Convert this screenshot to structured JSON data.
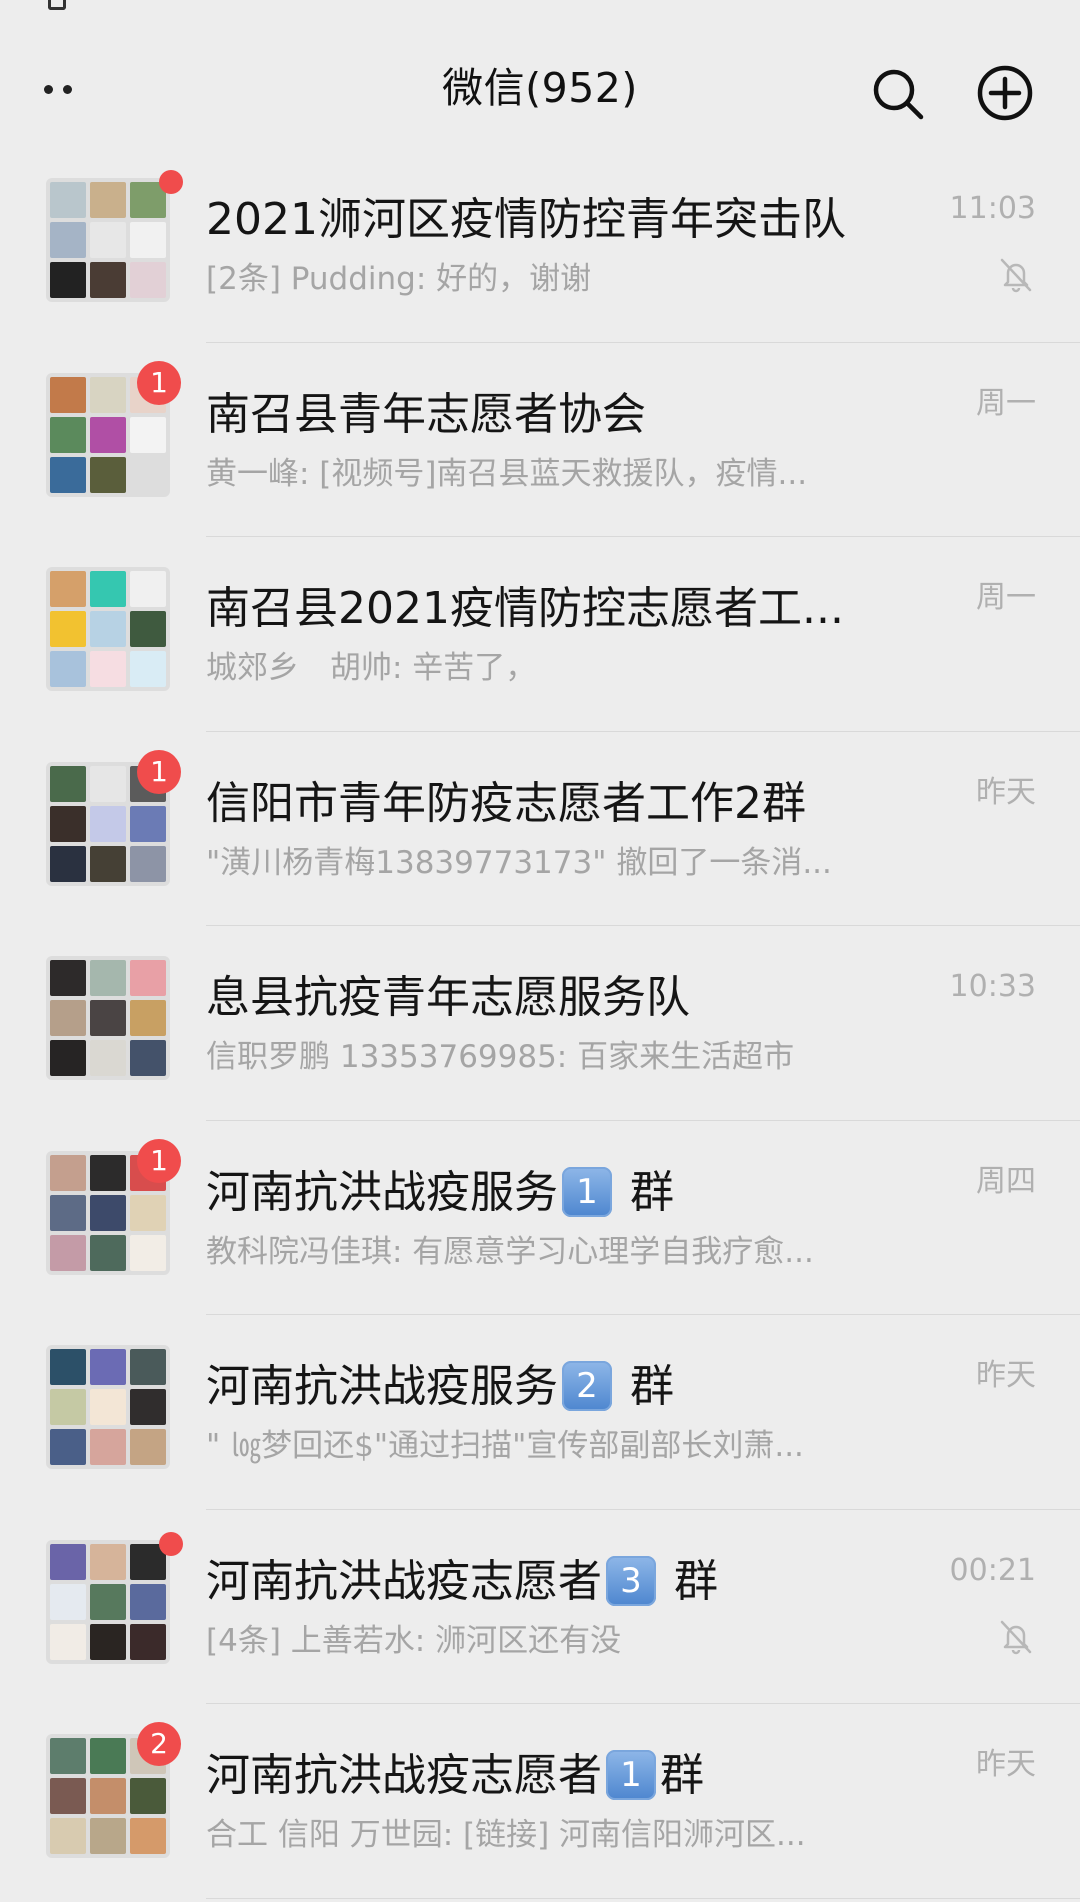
{
  "header": {
    "title": "微信(952)"
  },
  "colors": {
    "badge": "#f04c4c",
    "background": "#ededed",
    "preview_text": "#a5a5a5"
  },
  "chats": [
    {
      "name": "2021浉河区疫情防控青年突击队",
      "preview": "[2条] Pudding: 好的，谢谢",
      "time": "11:03",
      "badge": "",
      "dot": true,
      "muted": true,
      "avatar_colors": [
        "#b9c6cc",
        "#c9b08c",
        "#7e9d6a",
        "#a5b4c6",
        "#e7e7e7",
        "#f1f1f1",
        "#222",
        "#4a3c34",
        "#e2d0d6"
      ]
    },
    {
      "name": "南召县青年志愿者协会",
      "preview": "黄一峰: [视频号]南召县蓝天救援队，疫情...",
      "time": "周一",
      "badge": "1",
      "dot": false,
      "muted": false,
      "avatar_colors": [
        "#c27a4a",
        "#d8d4c2",
        "#e8d3c9",
        "#5b8a5c",
        "#b04fa5",
        "#f3f3f3",
        "#3a6b9a",
        "#5a5e3b",
        "#ddd"
      ]
    },
    {
      "name": "南召县2021疫情防控志愿者工...",
      "preview": "城郊乡　胡帅: 辛苦了，",
      "time": "周一",
      "badge": "",
      "dot": false,
      "muted": false,
      "avatar_colors": [
        "#d5a06a",
        "#35c7b0",
        "#f0f0f0",
        "#f2c230",
        "#b7d2e4",
        "#3f5a3f",
        "#a8c2dc",
        "#f6dde2",
        "#d9ecf5"
      ]
    },
    {
      "name": "信阳市青年防疫志愿者工作2群",
      "preview": "\"潢川杨青梅13839773173\" 撤回了一条消...",
      "time": "昨天",
      "badge": "1",
      "dot": false,
      "muted": false,
      "avatar_colors": [
        "#4a6a4b",
        "#e6e6e6",
        "#5b5b5b",
        "#3a2f2a",
        "#c4c9e8",
        "#6b7bb5",
        "#2a3140",
        "#454035",
        "#8d94a6"
      ]
    },
    {
      "name": "息县抗疫青年志愿服务队",
      "preview": "信职罗鹏 13353769985: 百家来生活超市",
      "time": "10:33",
      "badge": "",
      "dot": false,
      "muted": false,
      "avatar_colors": [
        "#2d2a2a",
        "#a5b7ad",
        "#e8a0a6",
        "#b59f8a",
        "#4a4444",
        "#c8a063",
        "#262424",
        "#dad8d2",
        "#44526a"
      ]
    },
    {
      "name_parts": [
        "河南抗洪战疫服务",
        "1",
        " 群"
      ],
      "name": "河南抗洪战疫服务1️⃣ 群",
      "preview": "教科院冯佳琪: 有愿意学习心理学自我疗愈...",
      "time": "周四",
      "badge": "1",
      "dot": false,
      "muted": false,
      "avatar_colors": [
        "#c49f8e",
        "#2c2b2b",
        "#d84d4d",
        "#5d6b86",
        "#3d4a6a",
        "#e0d2b5",
        "#c49ba7",
        "#4e6a5c",
        "#f2ede6"
      ]
    },
    {
      "name_parts": [
        "河南抗洪战疫服务",
        "2",
        " 群"
      ],
      "name": "河南抗洪战疫服务2️⃣ 群",
      "preview": "\" ㏒梦回还$\"通过扫描\"宣传部副部长刘萧...",
      "time": "昨天",
      "badge": "",
      "dot": false,
      "muted": false,
      "avatar_colors": [
        "#2c5068",
        "#6b6bb4",
        "#4a5a5a",
        "#c5c9a4",
        "#f3e6d6",
        "#302d2d",
        "#4a5f88",
        "#d6a59c",
        "#c4a484"
      ]
    },
    {
      "name_parts": [
        "河南抗洪战疫志愿者",
        "3",
        " 群"
      ],
      "name": "河南抗洪战疫志愿者3️⃣ 群",
      "preview": "[4条] 上善若水: 浉河区还有没",
      "time": "00:21",
      "badge": "",
      "dot": true,
      "muted": true,
      "avatar_colors": [
        "#6a64a8",
        "#d6b49a",
        "#2b2b2b",
        "#e5eaf0",
        "#57795d",
        "#5a6a9d",
        "#f1ece6",
        "#2a2522",
        "#3b2a2a"
      ]
    },
    {
      "name_parts": [
        "河南抗洪战疫志愿者",
        "1",
        "群"
      ],
      "name": "河南抗洪战疫志愿者1️⃣群",
      "preview": "合工 信阳 万世园: [链接] 河南信阳浉河区...",
      "time": "昨天",
      "badge": "2",
      "dot": false,
      "muted": false,
      "avatar_colors": [
        "#5d7d6c",
        "#4a7a55",
        "#cfc6b8",
        "#7a5a52",
        "#c48e6a",
        "#4a5a3a",
        "#d8cbb0",
        "#b8a78a",
        "#d59a6a"
      ]
    }
  ]
}
